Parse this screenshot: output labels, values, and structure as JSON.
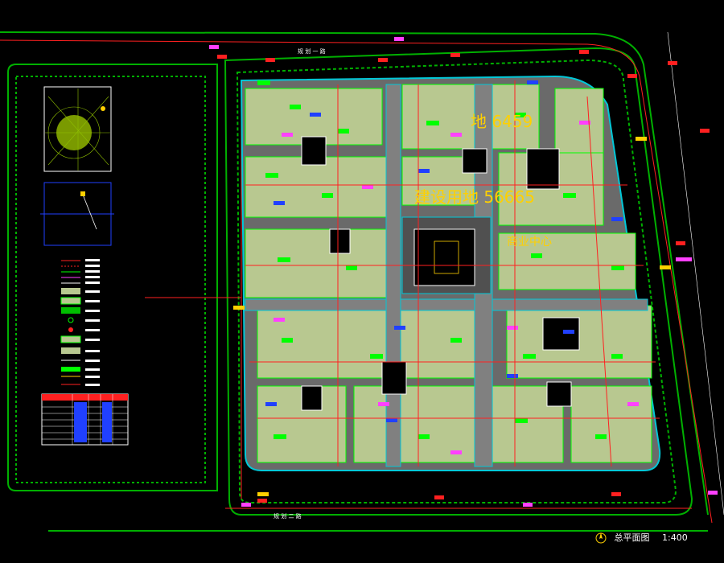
{
  "drawing": {
    "title": "总平面图",
    "scale": "1:400",
    "north_arrow_icon": "north-arrow-icon"
  },
  "overlay_labels": {
    "area_1": "地 6459",
    "area_2": "建设用地 56665",
    "zone_label": "商业中心"
  },
  "road_labels": {
    "north_road": "规 划 一 路",
    "south_road": "规 划 二 路"
  },
  "plan_colors": {
    "background": "#000000",
    "road_green": "#00b000",
    "block_cyan": "#00c8d8",
    "building_fill": "#b8c890",
    "paving_gray": "#808080",
    "red_line": "#ff2020",
    "yellow_text": "#ffd000",
    "magenta": "#ff40ff",
    "blue_block": "#2040ff",
    "lime": "#00ff00"
  }
}
